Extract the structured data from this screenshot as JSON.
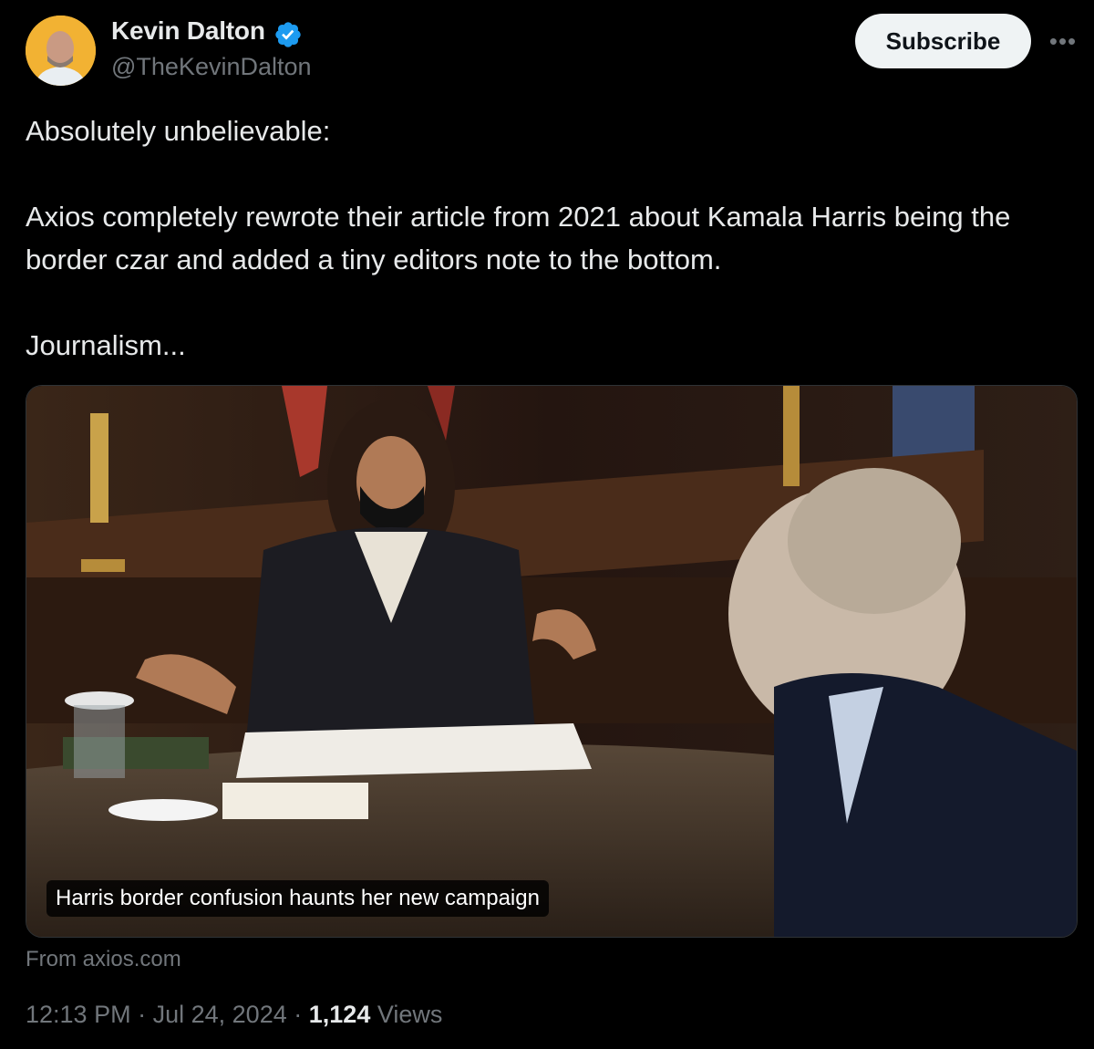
{
  "author": {
    "name": "Kevin Dalton",
    "handle": "@TheKevinDalton",
    "verified": true
  },
  "header": {
    "subscribe_label": "Subscribe",
    "more_icon": "more-horizontal-icon"
  },
  "tweet": {
    "paragraphs": [
      "Absolutely unbelievable:",
      "Axios completely rewrote their article from 2021 about Kamala Harris being the border czar and added a tiny editors note to the bottom.",
      "Journalism..."
    ]
  },
  "card": {
    "caption": "Harris border confusion haunts her new campaign",
    "source": "From axios.com"
  },
  "meta": {
    "time": "12:13 PM",
    "date": "Jul 24, 2024",
    "separator": "·",
    "views_count": "1,124",
    "views_label": "Views"
  },
  "colors": {
    "background": "#000000",
    "text": "#e7e9ea",
    "muted": "#71767b",
    "verified_badge": "#1d9bf0",
    "subscribe_bg": "#eff3f4"
  }
}
